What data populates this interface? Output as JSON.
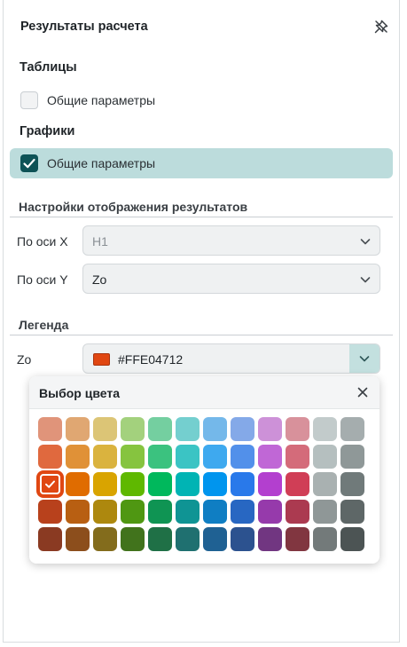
{
  "panel": {
    "title": "Результаты расчета",
    "tables_title": "Таблицы",
    "tables_item": "Общие параметры",
    "tables_item_checked": false,
    "graphs_title": "Графики",
    "graphs_item": "Общие параметры",
    "graphs_item_checked": true,
    "display_title": "Настройки отображения результатов",
    "x_label": "По оси X",
    "x_value": "H1",
    "y_label": "По оси Y",
    "y_value": "Zo",
    "legend_title": "Легенда",
    "legend_label": "Zo",
    "legend_color_value": "#FFE04712",
    "legend_color": "#e04712"
  },
  "picker": {
    "title": "Выбор цвета",
    "selected": [
      2,
      0
    ],
    "rows": [
      [
        "#e0947a",
        "#e0a772",
        "#dcc576",
        "#a3d17d",
        "#74cfa0",
        "#74cfcf",
        "#74b8ea",
        "#84a9e8",
        "#cd91d8",
        "#d8919b",
        "#c2cbcb",
        "#a5adae"
      ],
      [
        "#e0693e",
        "#e09137",
        "#dab33e",
        "#86c43f",
        "#3bc27f",
        "#3bc4c4",
        "#3ea9ef",
        "#5290ea",
        "#c067d6",
        "#d46b7a",
        "#b5bfbf",
        "#8f9898"
      ],
      [
        "#e04712",
        "#e06c00",
        "#d9a400",
        "#5fb800",
        "#00b85c",
        "#00b4b4",
        "#0095ee",
        "#2979ea",
        "#b33fcf",
        "#d03e56",
        "#a9b1b1",
        "#707a7a"
      ],
      [
        "#b8411c",
        "#b85f12",
        "#ad880e",
        "#4f9712",
        "#0f9453",
        "#0f9494",
        "#0f7ec3",
        "#2867c2",
        "#963aab",
        "#ab3a50",
        "#8f9797",
        "#5e6767"
      ],
      [
        "#8a3a22",
        "#8c4e1c",
        "#836c1c",
        "#41731c",
        "#1f7046",
        "#1f7070",
        "#1f6193",
        "#2c528f",
        "#713681",
        "#813640",
        "#737a7a",
        "#4c5454"
      ]
    ]
  }
}
